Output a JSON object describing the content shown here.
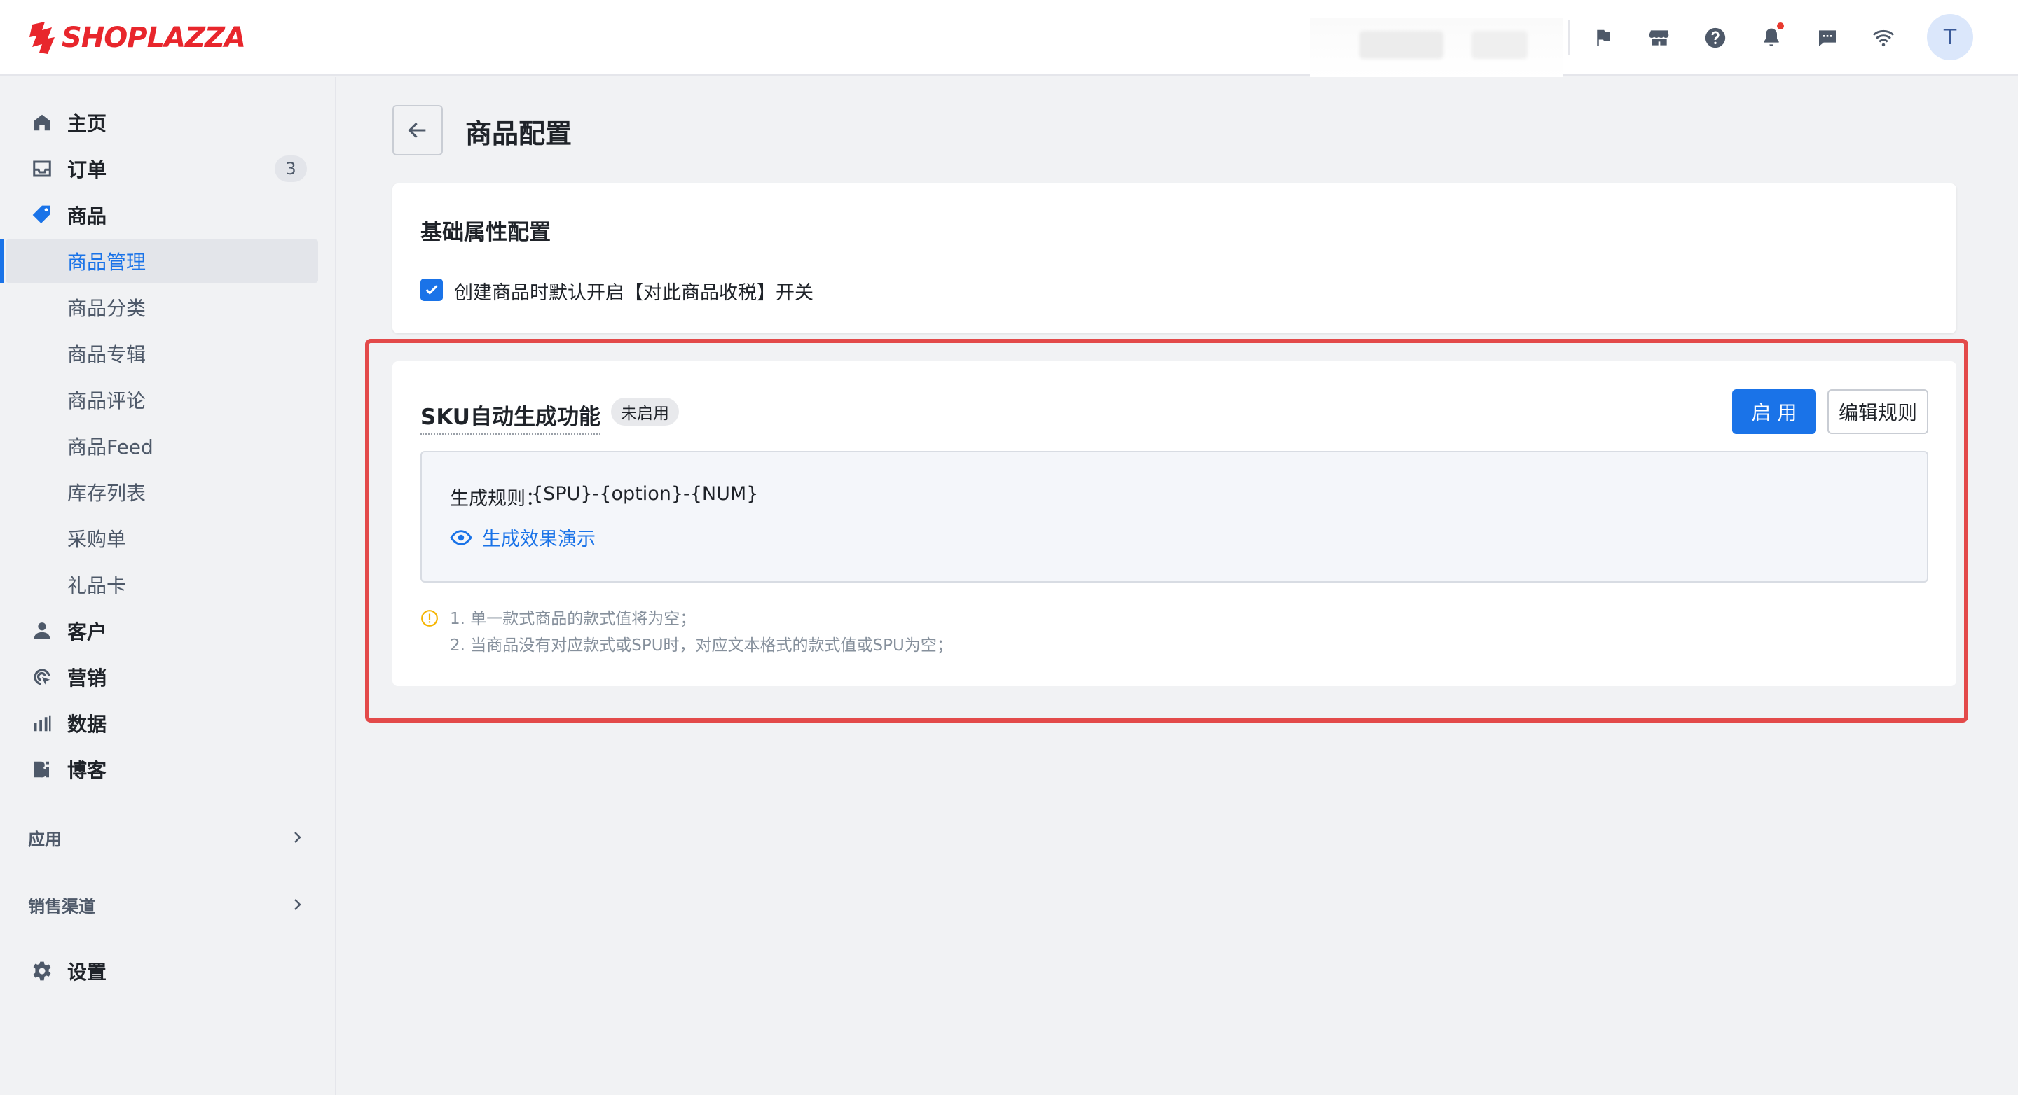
{
  "brand": {
    "name": "SHOPLAZZA",
    "color": "#e8262c"
  },
  "header": {
    "icons": [
      "flag-icon",
      "store-icon",
      "help-icon",
      "bell-icon",
      "message-icon",
      "wifi-icon"
    ],
    "avatar_initial": "T"
  },
  "sidebar": {
    "items": [
      {
        "label": "主页",
        "icon": "home-icon"
      },
      {
        "label": "订单",
        "icon": "inbox-icon",
        "badge": "3"
      },
      {
        "label": "商品",
        "icon": "tag-icon"
      },
      {
        "label": "客户",
        "icon": "person-icon"
      },
      {
        "label": "营销",
        "icon": "target-icon"
      },
      {
        "label": "数据",
        "icon": "bar-chart-icon"
      },
      {
        "label": "博客",
        "icon": "blog-icon"
      }
    ],
    "sub_items": [
      "商品管理",
      "商品分类",
      "商品专辑",
      "商品评论",
      "商品Feed",
      "库存列表",
      "采购单",
      "礼品卡"
    ],
    "active_sub": "商品管理",
    "sections": [
      "应用",
      "销售渠道"
    ],
    "settings_label": "设置"
  },
  "main": {
    "page_title": "商品配置",
    "basic": {
      "title": "基础属性配置",
      "checkbox_label": "创建商品时默认开启【对此商品收税】开关",
      "checked": true
    },
    "sku": {
      "title": "SKU自动生成功能",
      "status": "未启用",
      "enable_button": "启 用",
      "edit_button": "编辑规则",
      "rule_label": "生成规则：",
      "rule_value": "{SPU}-{option}-{NUM}",
      "demo_link": "生成效果演示",
      "notes": [
        "1. 单一款式商品的款式值将为空；",
        "2. 当商品没有对应款式或SPU时，对应文本格式的款式值或SPU为空；"
      ]
    }
  },
  "colors": {
    "accent": "#1a73e8",
    "highlight": "#e34a4a",
    "warning": "#f5b400"
  }
}
